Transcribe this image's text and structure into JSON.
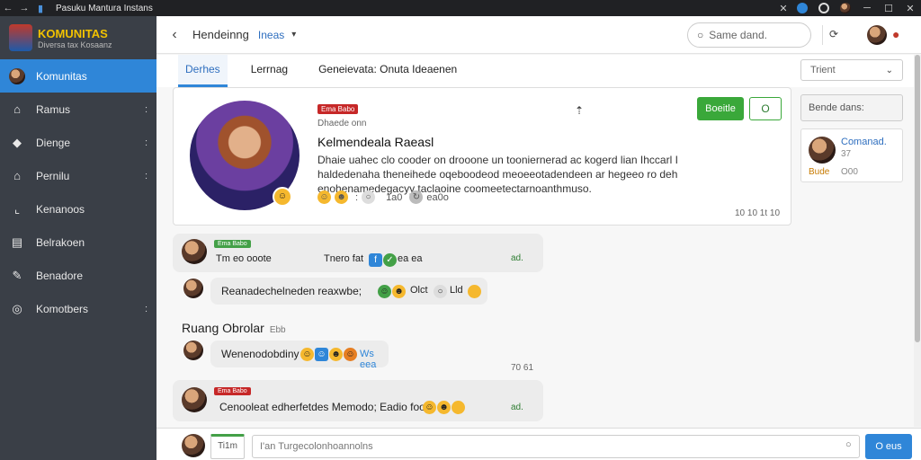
{
  "window": {
    "title": "Pasuku Mantura Instans"
  },
  "app": {
    "logo_title": "KOMUNITAS",
    "logo_subtitle": "Diversa tax Kosaanz"
  },
  "sidebar": {
    "items": [
      {
        "label": "Komunitas",
        "icon": "avatar-icon",
        "active": true
      },
      {
        "label": "Ramus",
        "icon": "home-icon",
        "chevron": ":"
      },
      {
        "label": "Dienge",
        "icon": "tag-icon",
        "chevron": ":"
      },
      {
        "label": "Pernilu",
        "icon": "house-icon",
        "chevron": ":"
      },
      {
        "label": "Kenanoos",
        "icon": "corner-icon"
      },
      {
        "label": "Belrakoen",
        "icon": "list-icon"
      },
      {
        "label": "Benadore",
        "icon": "brush-icon"
      },
      {
        "label": "Komotbers",
        "icon": "circle-icon",
        "chevron": ":"
      }
    ]
  },
  "header": {
    "title": "Hendeinng",
    "subtitle": "Ineas",
    "search_placeholder": "Same dand."
  },
  "tabs": [
    "Derhes",
    "Lerrnag",
    "Geneievata: Onuta Ideaenen"
  ],
  "filter": {
    "value": "Trient"
  },
  "profile": {
    "badge": "Ema Babo",
    "meta": "Dhaede  onn",
    "name": "Kelmendeala Raeasl",
    "description": "Dhaie uahec clo cooder on drooone un tooniernerad ac kogerd lian Ihccarl I haldedenaha theneihede oqeboodeod meoeeotadendeen ar hegeeo ro deh enohenamedegacyy taclaoine coomeetectarnoanthmuso.",
    "reactions_count": "1a0",
    "reactions_extra": "ea0o",
    "timestamp": "10 10  1t 10",
    "follow_label": "Boeitle",
    "message_label": "O"
  },
  "right_panel": {
    "title": "Bende dans:",
    "user": {
      "name": "Comanad.",
      "sub": "37",
      "badge": "Bude",
      "count": "O00"
    }
  },
  "messages": [
    {
      "badge": "Ema Babo",
      "name": "Tm eo ooote",
      "meta": "Tnero fat",
      "meta_nums": "ea ea",
      "side": "ad."
    },
    {
      "text": "Reanadechelneden reaxwbe;",
      "count": "Olct",
      "count2": "Lld"
    },
    {
      "text": "Wenenodobdiny",
      "link": "Ws eea",
      "time": "70 61"
    },
    {
      "badge": "Ema Babo",
      "text": "Cenooleat edherfetdes Memodo; Eadio fooo",
      "side": "ad."
    }
  ],
  "room": {
    "title": "Ruang Obrolar",
    "count": "Ebb"
  },
  "composer": {
    "badge": "Ti1m",
    "placeholder": "I'an Turgecolonhoannolns",
    "send_label": "O eus"
  },
  "colors": {
    "accent": "#2f86d8",
    "follow": "#3aa83a",
    "sidebar": "#3a3f47",
    "badge_red": "#c62828",
    "badge_green": "#43a047"
  }
}
